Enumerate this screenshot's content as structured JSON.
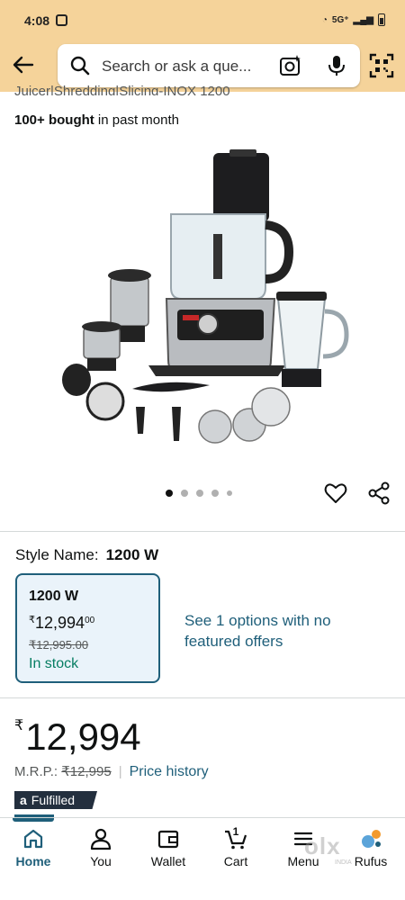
{
  "status_bar": {
    "time": "4:08",
    "network": "5G⁺"
  },
  "search": {
    "placeholder": "Search or ask a que..."
  },
  "product": {
    "title_partial": "Juicer|Shredding|Slicing-INOX 1200",
    "bought_bold": "100+ bought",
    "bought_rest": " in past month"
  },
  "gallery": {
    "dots": 5,
    "active_dot": 1
  },
  "style": {
    "label": "Style Name:",
    "value": "1200 W"
  },
  "variant_card": {
    "title": "1200 W",
    "price_symbol": "₹",
    "price_main": "12,994",
    "price_cents": "00",
    "mrp": "₹12,995.00",
    "stock": "In stock"
  },
  "see_options": "See 1 options with no featured offers",
  "pricing": {
    "symbol": "₹",
    "price": "12,994",
    "mrp_label": "M.R.P.:",
    "mrp_value": "₹12,995",
    "separator": "|",
    "history_link": "Price history"
  },
  "badge": {
    "logo": "a",
    "text": "Fulfilled"
  },
  "nav": {
    "home": "Home",
    "you": "You",
    "wallet": "Wallet",
    "cart": "Cart",
    "cart_count": "1",
    "menu": "Menu",
    "rufus": "Rufus"
  },
  "watermark": {
    "logo": "olx",
    "sub": "INDIA"
  },
  "colors": {
    "header_bg": "#f5d39a",
    "link": "#1f5f7a",
    "in_stock": "#067d62",
    "badge_bg": "#232f3e"
  }
}
